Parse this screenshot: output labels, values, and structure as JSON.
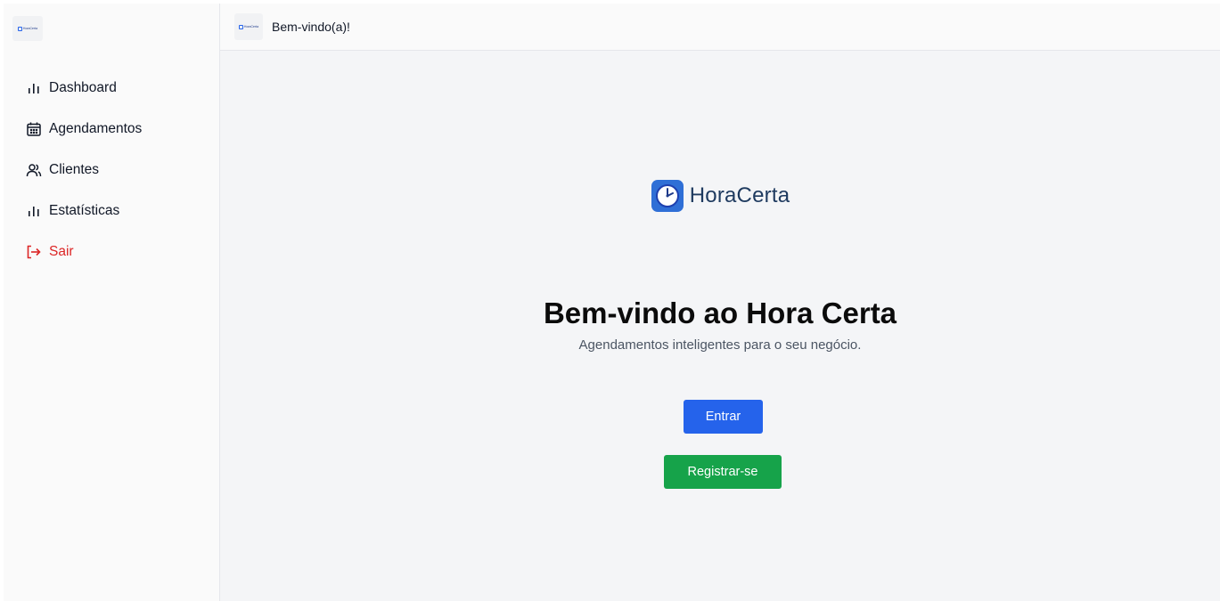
{
  "sidebar": {
    "logo_text": "HoraCerta",
    "items": [
      {
        "label": "Dashboard",
        "icon": "bar-chart-icon"
      },
      {
        "label": "Agendamentos",
        "icon": "calendar-icon"
      },
      {
        "label": "Clientes",
        "icon": "users-icon"
      },
      {
        "label": "Estatísticas",
        "icon": "bar-chart-icon"
      },
      {
        "label": "Sair",
        "icon": "logout-icon"
      }
    ]
  },
  "header": {
    "logo_text": "HoraCerta",
    "title": "Bem-vindo(a)!"
  },
  "main": {
    "brand_text": "HoraCerta",
    "title": "Bem-vindo ao Hora Certa",
    "subtitle": "Agendamentos inteligentes para o seu negócio.",
    "login_label": "Entrar",
    "register_label": "Registrar-se"
  },
  "colors": {
    "primary": "#2563eb",
    "success": "#16a34a",
    "danger": "#dc2626",
    "sidebar_bg": "#fafafa",
    "content_bg": "#f4f5f7"
  }
}
